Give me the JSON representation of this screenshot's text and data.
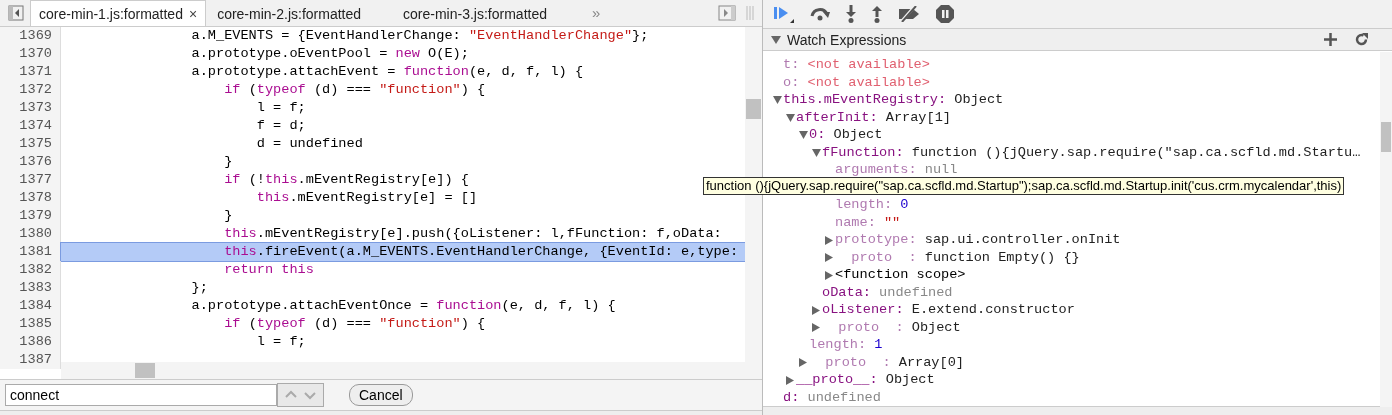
{
  "editor": {
    "tabs": [
      {
        "label": "core-min-1.js:formatted",
        "selected": true,
        "close": "×"
      },
      {
        "label": "core-min-2.js:formatted",
        "selected": false
      },
      {
        "label": "core-min-3.js:formatted",
        "selected": false
      }
    ],
    "overflow": "»",
    "lines": [
      {
        "number": "1369",
        "selected": false,
        "tokens": [
          {
            "kind": "plain",
            "text": "                a.M_EVENTS = {EventHandlerChange: "
          },
          {
            "kind": "string",
            "text": "\"EventHandlerChange\""
          },
          {
            "kind": "plain",
            "text": "};"
          }
        ]
      },
      {
        "number": "1370",
        "selected": false,
        "tokens": [
          {
            "kind": "plain",
            "text": "                a.prototype.oEventPool = "
          },
          {
            "kind": "keyword",
            "text": "new"
          },
          {
            "kind": "plain",
            "text": " O(E);"
          }
        ]
      },
      {
        "number": "1371",
        "selected": false,
        "tokens": [
          {
            "kind": "plain",
            "text": "                a.prototype.attachEvent = "
          },
          {
            "kind": "keyword",
            "text": "function"
          },
          {
            "kind": "plain",
            "text": "(e, d, f, l) {"
          }
        ]
      },
      {
        "number": "1372",
        "selected": false,
        "tokens": [
          {
            "kind": "keyword",
            "text": "                    if"
          },
          {
            "kind": "plain",
            "text": " ("
          },
          {
            "kind": "keyword",
            "text": "typeof"
          },
          {
            "kind": "plain",
            "text": " (d) === "
          },
          {
            "kind": "string",
            "text": "\"function\""
          },
          {
            "kind": "plain",
            "text": ") {"
          }
        ]
      },
      {
        "number": "1373",
        "selected": false,
        "tokens": [
          {
            "kind": "plain",
            "text": "                        l = f;"
          }
        ]
      },
      {
        "number": "1374",
        "selected": false,
        "tokens": [
          {
            "kind": "plain",
            "text": "                        f = d;"
          }
        ]
      },
      {
        "number": "1375",
        "selected": false,
        "tokens": [
          {
            "kind": "plain",
            "text": "                        d = undefined"
          }
        ]
      },
      {
        "number": "1376",
        "selected": false,
        "tokens": [
          {
            "kind": "plain",
            "text": "                    }"
          }
        ]
      },
      {
        "number": "1377",
        "selected": false,
        "tokens": [
          {
            "kind": "keyword",
            "text": "                    if"
          },
          {
            "kind": "plain",
            "text": " (!"
          },
          {
            "kind": "keyword",
            "text": "this"
          },
          {
            "kind": "plain",
            "text": ".mEventRegistry[e]) {"
          }
        ]
      },
      {
        "number": "1378",
        "selected": false,
        "tokens": [
          {
            "kind": "keyword",
            "text": "                        this"
          },
          {
            "kind": "plain",
            "text": ".mEventRegistry[e] = []"
          }
        ]
      },
      {
        "number": "1379",
        "selected": false,
        "tokens": [
          {
            "kind": "plain",
            "text": "                    }"
          }
        ]
      },
      {
        "number": "1380",
        "selected": false,
        "tokens": [
          {
            "kind": "keyword",
            "text": "                    this"
          },
          {
            "kind": "plain",
            "text": ".mEventRegistry[e].push({oListener: l,fFunction: f,oData:"
          }
        ]
      },
      {
        "number": "1381",
        "selected": true,
        "tokens": [
          {
            "kind": "keyword",
            "text": "                    this"
          },
          {
            "kind": "plain",
            "text": ".fireEvent(a.M_EVENTS.EventHandlerChange, {EventId: e,type:"
          }
        ]
      },
      {
        "number": "1382",
        "selected": false,
        "tokens": [
          {
            "kind": "keyword",
            "text": "                    return"
          },
          {
            "kind": "keyword",
            "text": " this"
          }
        ]
      },
      {
        "number": "1383",
        "selected": false,
        "tokens": [
          {
            "kind": "plain",
            "text": "                };"
          }
        ]
      },
      {
        "number": "1384",
        "selected": false,
        "tokens": [
          {
            "kind": "plain",
            "text": "                a.prototype.attachEventOnce = "
          },
          {
            "kind": "keyword",
            "text": "function"
          },
          {
            "kind": "plain",
            "text": "(e, d, f, l) {"
          }
        ]
      },
      {
        "number": "1385",
        "selected": false,
        "tokens": [
          {
            "kind": "keyword",
            "text": "                    if"
          },
          {
            "kind": "plain",
            "text": " ("
          },
          {
            "kind": "keyword",
            "text": "typeof"
          },
          {
            "kind": "plain",
            "text": " (d) === "
          },
          {
            "kind": "string",
            "text": "\"function\""
          },
          {
            "kind": "plain",
            "text": ") {"
          }
        ]
      },
      {
        "number": "1386",
        "selected": false,
        "tokens": [
          {
            "kind": "plain",
            "text": "                        l = f;"
          }
        ]
      },
      {
        "number": "1387",
        "selected": false
      }
    ],
    "search": {
      "value": "connect",
      "cancel": "Cancel"
    }
  },
  "watch": {
    "title": "Watch Expressions",
    "nodes": [
      {
        "kind": "property",
        "name": "t:",
        "value": {
          "kind": "error",
          "text": "<not available>"
        },
        "dim": true
      },
      {
        "kind": "property",
        "name": "o:",
        "value": {
          "kind": "error",
          "text": "<not available>"
        },
        "dim": true
      },
      {
        "kind": "property",
        "name": "this.mEventRegistry:",
        "value": {
          "kind": "object",
          "text": "Object"
        },
        "dim": false,
        "expanded": true,
        "children": [
          {
            "kind": "property",
            "name": "afterInit:",
            "value": {
              "kind": "object",
              "text": "Array[1]"
            },
            "dim": false,
            "expanded": true,
            "children": [
              {
                "kind": "property",
                "name": "0:",
                "value": {
                  "kind": "object",
                  "text": "Object"
                },
                "dim": false,
                "expanded": true,
                "children": [
                  {
                    "kind": "property",
                    "name": "fFunction:",
                    "value": {
                      "kind": "object",
                      "text": "function (){jQuery.sap.require(\"sap.ca.scfld.md.Startu…"
                    },
                    "dim": false,
                    "expanded": true,
                    "children": [
                      {
                        "kind": "property",
                        "name": "arguments:",
                        "value": {
                          "kind": "null",
                          "text": "null"
                        },
                        "dim": true
                      },
                      {
                        "kind": "tooltip",
                        "text": "function (){jQuery.sap.require(\"sap.ca.scfld.md.Startup\");sap.ca.scfld.md.Startup.init('cus.crm.mycalendar',this)"
                      },
                      {
                        "kind": "property",
                        "name": "length:",
                        "value": {
                          "kind": "number",
                          "text": "0"
                        },
                        "dim": true
                      },
                      {
                        "kind": "property",
                        "name": "name:",
                        "value": {
                          "kind": "string",
                          "text": "\"\""
                        },
                        "dim": true
                      },
                      {
                        "kind": "property",
                        "name": "prototype:",
                        "value": {
                          "kind": "object",
                          "text": "sap.ui.controller.onInit"
                        },
                        "dim": true,
                        "expanded": false
                      },
                      {
                        "kind": "property",
                        "name": "proto  :",
                        "value": {
                          "kind": "object",
                          "text": "function Empty() {}"
                        },
                        "dim": true,
                        "expanded": false
                      },
                      {
                        "kind": "scope",
                        "name": "<function scope>",
                        "expanded": false
                      }
                    ]
                  },
                  {
                    "kind": "property",
                    "name": "oData:",
                    "value": {
                      "kind": "null",
                      "text": "undefined"
                    },
                    "dim": false
                  },
                  {
                    "kind": "property",
                    "name": "oListener:",
                    "value": {
                      "kind": "object",
                      "text": "E.extend.constructor"
                    },
                    "dim": false,
                    "expanded": false
                  },
                  {
                    "kind": "property",
                    "name": "proto  :",
                    "value": {
                      "kind": "object",
                      "text": "Object"
                    },
                    "dim": true,
                    "expanded": false
                  }
                ]
              },
              {
                "kind": "property",
                "name": "length:",
                "value": {
                  "kind": "number",
                  "text": "1"
                },
                "dim": true
              },
              {
                "kind": "property",
                "name": "proto  :",
                "value": {
                  "kind": "object",
                  "text": "Array[0]"
                },
                "dim": true,
                "expanded": false
              }
            ]
          },
          {
            "kind": "property",
            "name": "__proto__:",
            "value": {
              "kind": "object",
              "text": "Object"
            },
            "dim": false,
            "expanded": false
          }
        ]
      },
      {
        "kind": "property",
        "name": "d:",
        "value": {
          "kind": "null",
          "text": "undefined"
        },
        "dim": false
      }
    ]
  }
}
